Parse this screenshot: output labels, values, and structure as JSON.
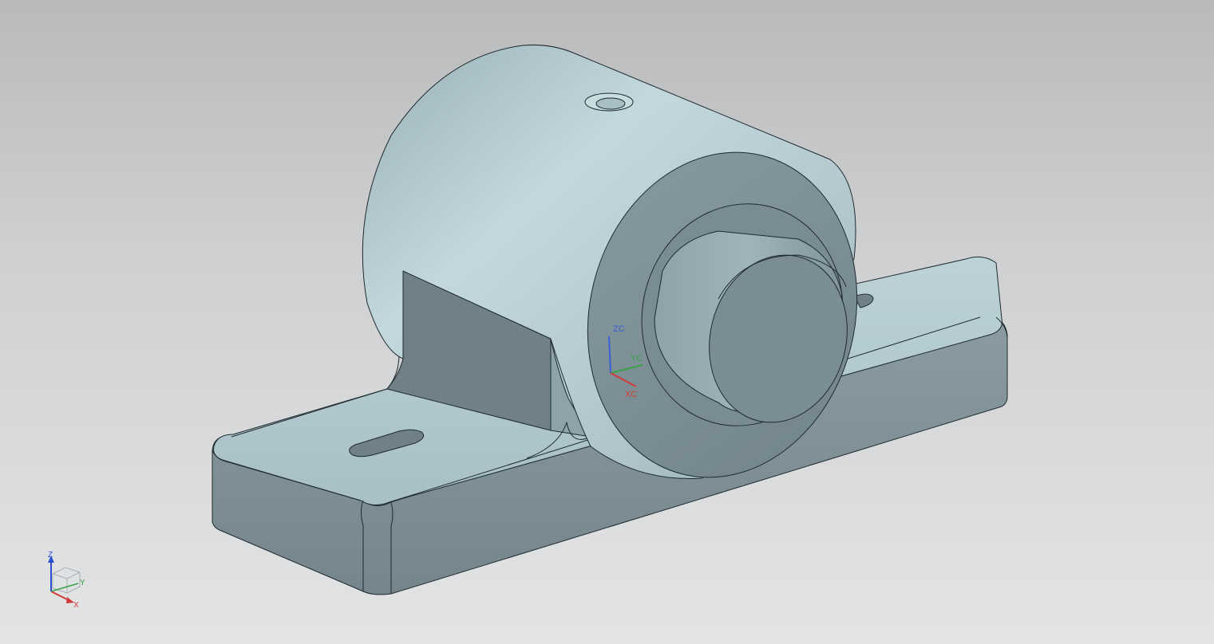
{
  "viewport": {
    "background_top": "#b9babb",
    "background_bottom": "#e3e4e5"
  },
  "model": {
    "body_color": "#a9c0c6",
    "shade_color": "#6f8187",
    "edge_color": "#1e2a2e"
  },
  "wcs": {
    "x_label": "XC",
    "y_label": "YC",
    "z_label": "ZC",
    "x_color": "#d23a3a",
    "y_color": "#3aa04a",
    "z_color": "#3a5fd2"
  },
  "view_triad": {
    "x_label": "X",
    "y_label": "Y",
    "z_label": "Z",
    "x_color": "#d23a3a",
    "y_color": "#3aa04a",
    "z_color": "#2a4fd0"
  }
}
